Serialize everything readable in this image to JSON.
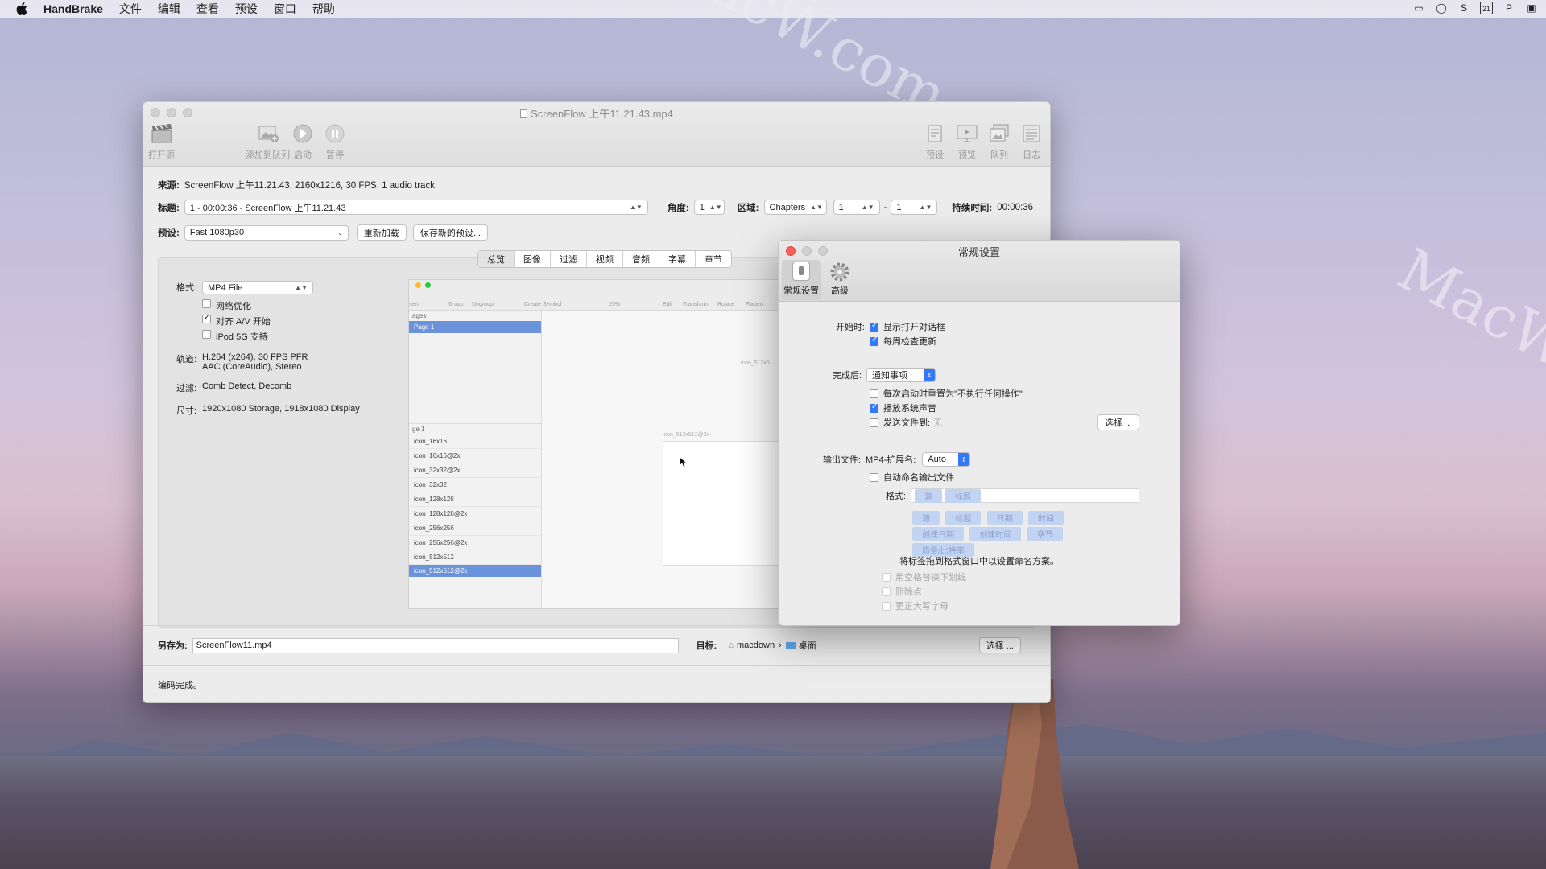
{
  "menubar": {
    "app_name": "HandBrake",
    "items": [
      "文件",
      "编辑",
      "查看",
      "预设",
      "窗口",
      "帮助"
    ],
    "status": [
      "▭",
      "◯",
      "S",
      "21",
      "P",
      "▣"
    ]
  },
  "watermark": "MacW.com",
  "main_window": {
    "title": "ScreenFlow 上午11.21.43.mp4",
    "toolbar": {
      "open": "打开源",
      "add_queue": "添加到队列",
      "start": "启动",
      "pause": "暂停",
      "presets": "预设",
      "preview": "预览",
      "queue": "队列",
      "log": "日志"
    },
    "source_label": "来源:",
    "source_value": "ScreenFlow 上午11.21.43, 2160x1216, 30 FPS, 1 audio track",
    "title_label": "标题:",
    "title_value": "1 - 00:00:36 - ScreenFlow 上午11.21.43",
    "angle_label": "角度:",
    "angle_value": "1",
    "range_label": "区域:",
    "range_type": "Chapters",
    "range_from": "1",
    "range_dash": "-",
    "range_to": "1",
    "duration_label": "持续时间:",
    "duration_value": "00:00:36",
    "preset_label": "预设:",
    "preset_value": "Fast 1080p30",
    "reload_button": "重新加载",
    "save_preset_button": "保存新的预设...",
    "tabs": [
      "总览",
      "图像",
      "过滤",
      "视频",
      "音频",
      "字幕",
      "章节"
    ],
    "summary": {
      "format_label": "格式:",
      "format_value": "MP4 File",
      "web_optimize": "网络优化",
      "align_av": "对齐 A/V 开始",
      "ipod": "iPod 5G 支持",
      "tracks_label": "轨道:",
      "tracks_line1": "H.264 (x264), 30 FPS PFR",
      "tracks_line2": "AAC (CoreAudio), Stereo",
      "filters_label": "过滤:",
      "filters_value": "Comb Detect, Decomb",
      "size_label": "尺寸:",
      "size_value": "1920x1080 Storage, 1918x1080 Display"
    },
    "preview": {
      "toolbar_labels": [
        "sert",
        "Group",
        "Ungroup",
        "Create Symbol",
        "25%",
        "Edit",
        "Transform",
        "Rotate",
        "Flatten"
      ],
      "pages_header": "ages",
      "page_selected": "Page 1",
      "layers_header": "ge 1",
      "items": [
        "icon_16x16",
        "icon_16x16@2x",
        "icon_32x32@2x",
        "icon_32x32",
        "icon_128x128",
        "icon_128x128@2x",
        "icon_256x256",
        "icon_256x256@2x",
        "icon_512x512"
      ],
      "item_selected": "icon_512x512@2x",
      "canvas_label": "icon_512x512@2x",
      "canvas_label2": "icon_512x5"
    },
    "save_as_label": "另存为:",
    "save_as_value": "ScreenFlow11.mp4",
    "dest_label": "目标:",
    "dest_user": "macdown",
    "dest_sep": "›",
    "dest_folder": "桌面",
    "choose_button": "选择 ...",
    "status": "编码完成。"
  },
  "prefs_window": {
    "title": "常规设置",
    "tab_general": "常规设置",
    "tab_advanced": "高级",
    "on_start_label": "开始时:",
    "show_open_dialog": "显示打开对话框",
    "check_updates": "每周检查更新",
    "when_done_label": "完成后:",
    "when_done_value": "通知事项",
    "reset_on_launch": "每次启动时重置为\"不执行任何操作\"",
    "play_sound": "播放系统声音",
    "send_file_to": "发送文件到:",
    "send_file_none": "无",
    "choose_button": "选择 ...",
    "output_label": "输出文件:",
    "mp4_ext_label": "MP4-扩展名:",
    "mp4_ext_value": "Auto",
    "auto_name": "自动命名输出文件",
    "format_label": "格式:",
    "format_tokens": [
      "源",
      "标题"
    ],
    "tokens_row1": [
      "源",
      "标题",
      "日期",
      "时间"
    ],
    "tokens_row2": [
      "创建日期",
      "创建时间",
      "章节"
    ],
    "tokens_row3": [
      "质量/比特率"
    ],
    "drag_hint": "将标签拖到格式窗口中以设置命名方案。",
    "replace_spaces": "用空格替换下划线",
    "remove_dots": "删除点",
    "fix_caps": "更正大写字母"
  }
}
